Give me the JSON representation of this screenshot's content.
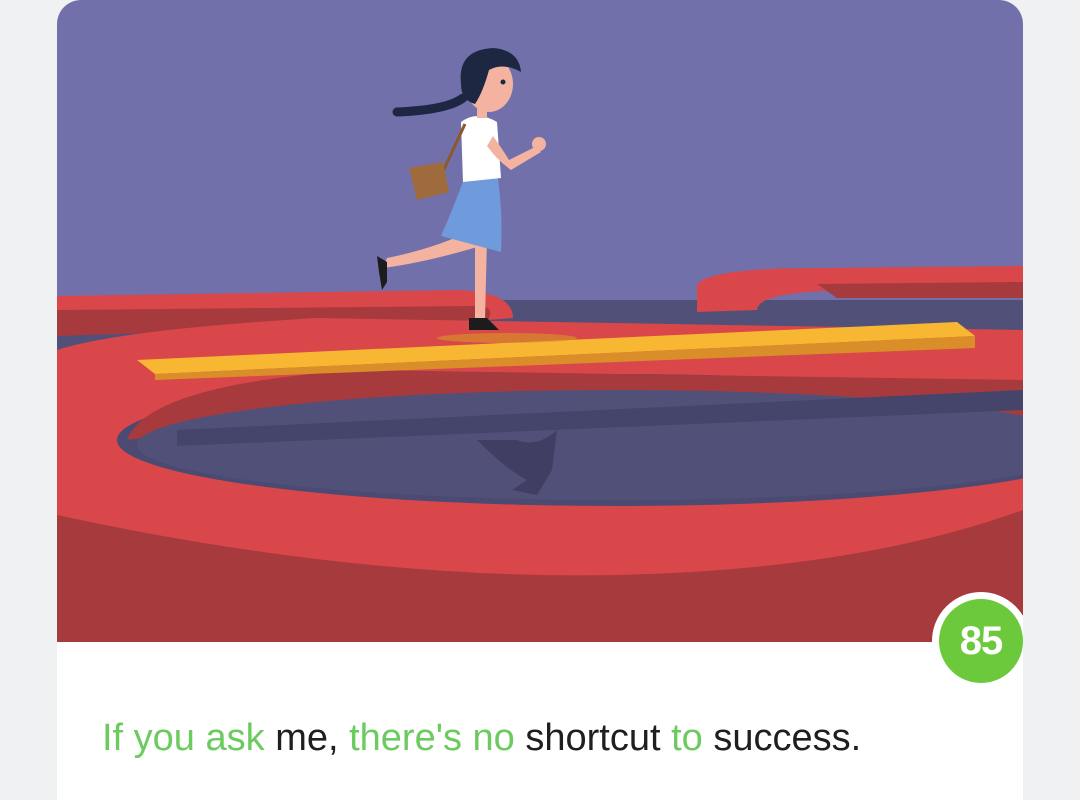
{
  "score": {
    "value": "85",
    "color": "#6cc93b"
  },
  "sentence": {
    "segments": [
      {
        "text": "If you ask ",
        "highlight": true
      },
      {
        "text": "me, ",
        "highlight": false
      },
      {
        "text": "there's no ",
        "highlight": true
      },
      {
        "text": "shortcut ",
        "highlight": false
      },
      {
        "text": "to ",
        "highlight": true
      },
      {
        "text": "success.",
        "highlight": false
      }
    ],
    "highlight_color": "#6ccb5f",
    "text_color": "#1f1f1f"
  },
  "illustration": {
    "subject": "woman-walking-on-plank-over-red-maze",
    "colors": {
      "sky": "#7270ab",
      "maze_top": "#d9474a",
      "maze_side": "#a63a3c",
      "plank": "#f7b733",
      "floor": "#515079"
    }
  }
}
